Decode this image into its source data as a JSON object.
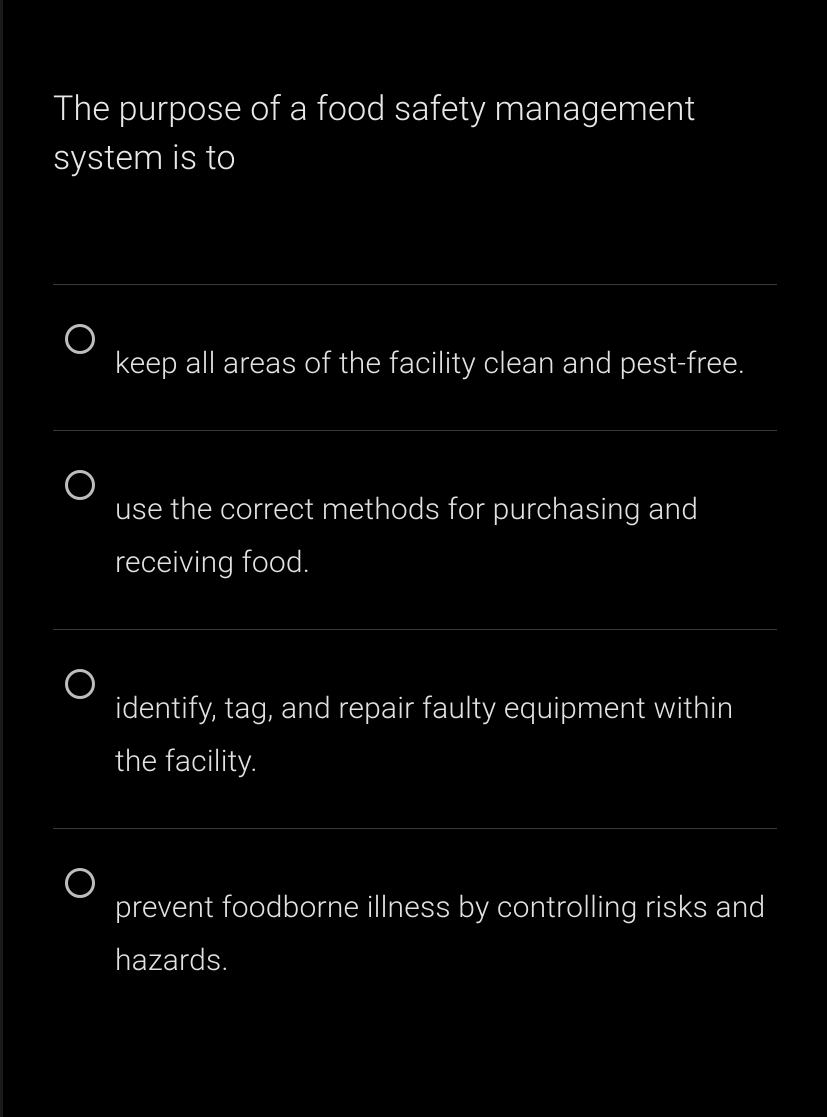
{
  "question": {
    "prompt": "The purpose of a food safety management system is to",
    "options": [
      {
        "label": "keep all areas of the facility clean and pest-free."
      },
      {
        "label": "use the correct methods for purchasing and receiving food."
      },
      {
        "label": "identify, tag, and repair faulty equipment within the facility."
      },
      {
        "label": "prevent foodborne illness by controlling risks and hazards."
      }
    ]
  }
}
